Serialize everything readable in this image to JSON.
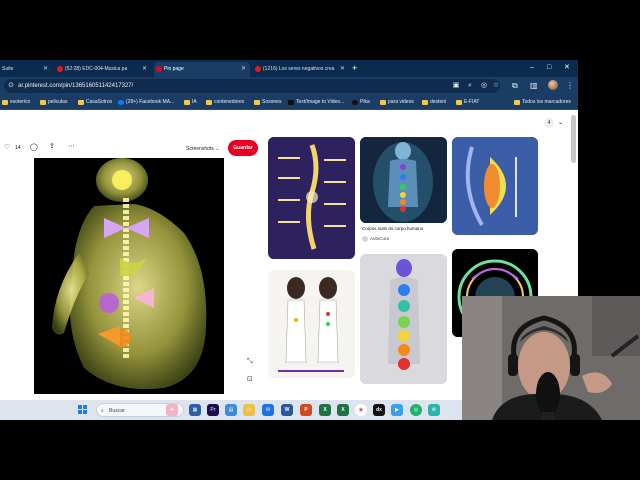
{
  "browser": {
    "tabs": [
      {
        "label": "Suite",
        "favicon": "none"
      },
      {
        "label": "(52:28) EDC-004-Musica pa",
        "favicon": "youtube-icon"
      },
      {
        "label": "Pin page",
        "favicon": "pinterest-icon",
        "active": true
      },
      {
        "label": "(1216) Los seres negativos crea",
        "favicon": "youtube-icon"
      }
    ],
    "new_tab": "+",
    "window_controls": [
      "–",
      "□",
      "✕"
    ],
    "address": "ar.pinterest.com/pin/136516051142417327/",
    "bookmarks": [
      {
        "label": "esoterico"
      },
      {
        "label": "peliculas"
      },
      {
        "label": "CasaSotros"
      },
      {
        "label": "(28+) Facebook MA..."
      },
      {
        "label": "IA"
      },
      {
        "label": "contenedores"
      },
      {
        "label": "Sosones"
      },
      {
        "label": "Text/Image to Video..."
      },
      {
        "label": "Pika"
      },
      {
        "label": "para videos"
      },
      {
        "label": "desteni"
      },
      {
        "label": "E-FIAT"
      },
      {
        "label": "Todos los marcadores"
      }
    ]
  },
  "pin": {
    "like_count": "14",
    "board": "Screenshots",
    "save_label": "Guardar"
  },
  "related": [
    {
      "caption": "",
      "source": ""
    },
    {
      "caption": "Corpos sutis do corpo humano",
      "source": "AutoCura"
    },
    {
      "caption": "",
      "source": ""
    },
    {
      "caption": "",
      "source": ""
    },
    {
      "caption": "",
      "source": ""
    },
    {
      "caption": "",
      "source": ""
    }
  ],
  "pager": {
    "label": "4"
  },
  "taskbar": {
    "search_placeholder": "Buscar",
    "apps": [
      "widgets-icon",
      "explorer-icon",
      "premiere-icon",
      "file-manager-icon",
      "folder-icon",
      "mail-icon",
      "word-icon",
      "powerpoint-icon",
      "excel-icon",
      "chrome-icon",
      "dx-icon",
      "media-icon",
      "vpn-icon",
      "settings-icon"
    ]
  },
  "colors": {
    "tabbar": "#0b2a4e",
    "toolbar": "#1a3d66",
    "pinterest_red": "#e60023"
  }
}
